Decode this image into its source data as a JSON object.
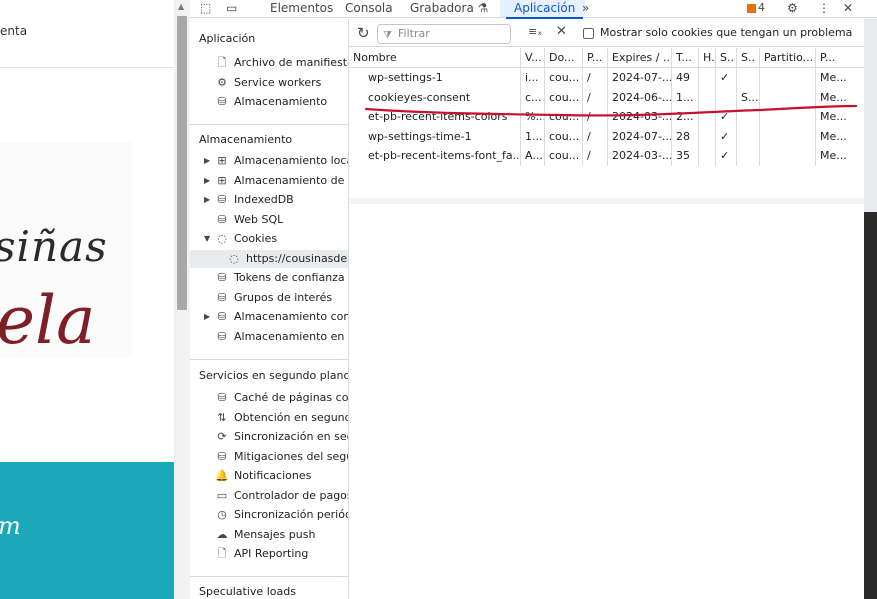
{
  "website": {
    "top_text": "enta",
    "logo_line1": "siñas",
    "logo_line2": "ela",
    "banner_text": "m"
  },
  "devtools": {
    "toolbar": {
      "tabs": [
        "Elementos",
        "Consola",
        "Grabadora",
        "Aplicación"
      ],
      "active_tab": "Aplicación",
      "more": "»",
      "issues_count": "4",
      "gear": "⚙",
      "menu": "⋮",
      "close": "✕"
    },
    "sidebar": {
      "app_title": "Aplicación",
      "app_items": [
        {
          "icon": "file-icon",
          "glyph": "🗋",
          "label": "Archivo de manifiesto"
        },
        {
          "icon": "gears-icon",
          "glyph": "⚙",
          "label": "Service workers"
        },
        {
          "icon": "database-icon",
          "glyph": "⛁",
          "label": "Almacenamiento"
        }
      ],
      "storage_title": "Almacenamiento",
      "storage_items": [
        {
          "icon": "table-icon",
          "glyph": "⊞",
          "label": "Almacenamiento local",
          "expandable": true
        },
        {
          "icon": "table-icon",
          "glyph": "⊞",
          "label": "Almacenamiento de sesión",
          "expandable": true
        },
        {
          "icon": "database-icon",
          "glyph": "⛁",
          "label": "IndexedDB",
          "expandable": true
        },
        {
          "icon": "database-icon",
          "glyph": "⛁",
          "label": "Web SQL",
          "expandable": false
        },
        {
          "icon": "cookie-icon",
          "glyph": "◌",
          "label": "Cookies",
          "expanded": true
        },
        {
          "icon": "cookie-icon",
          "glyph": "◌",
          "label": "https://cousinasdekela.com",
          "child": true,
          "selected": true
        },
        {
          "icon": "database-icon",
          "glyph": "⛁",
          "label": "Tokens de confianza"
        },
        {
          "icon": "database-icon",
          "glyph": "⛁",
          "label": "Grupos de interés"
        },
        {
          "icon": "database-icon",
          "glyph": "⛁",
          "label": "Almacenamiento compartido",
          "expandable": true
        },
        {
          "icon": "database-icon",
          "glyph": "⛁",
          "label": "Almacenamiento en caché"
        }
      ],
      "bg_title": "Servicios en segundo plano",
      "bg_items": [
        {
          "icon": "database-icon",
          "glyph": "⛁",
          "label": "Caché de páginas completas"
        },
        {
          "icon": "sync-arrows-icon",
          "glyph": "⇅",
          "label": "Obtención en segundo plano"
        },
        {
          "icon": "sync-icon",
          "glyph": "⟳",
          "label": "Sincronización en segundo plano"
        },
        {
          "icon": "database-icon",
          "glyph": "⛁",
          "label": "Mitigaciones del seguimiento"
        },
        {
          "icon": "bell-icon",
          "glyph": "🔔",
          "label": "Notificaciones"
        },
        {
          "icon": "card-icon",
          "glyph": "▭",
          "label": "Controlador de pagos"
        },
        {
          "icon": "clock-icon",
          "glyph": "◷",
          "label": "Sincronización periódica"
        },
        {
          "icon": "cloud-icon",
          "glyph": "☁",
          "label": "Mensajes push"
        },
        {
          "icon": "file-icon",
          "glyph": "🗋",
          "label": "API Reporting"
        }
      ],
      "spec_title": "Speculative loads"
    },
    "filter": {
      "placeholder": "Filtrar",
      "checkbox_label": "Mostrar solo cookies que tengan un problema"
    },
    "table": {
      "headers": [
        "Nombre",
        "V...",
        "Do...",
        "P...",
        "Expires / ...",
        "T...",
        "H.",
        "S..",
        "S..",
        "Partitio...",
        "P..."
      ],
      "rows": [
        [
          "wp-settings-1",
          "i...",
          "cou...",
          "/",
          "2024-07-...",
          "49",
          "",
          "✓",
          "",
          "",
          "Me..."
        ],
        [
          "cookieyes-consent",
          "c...",
          "cou...",
          "/",
          "2024-06-...",
          "1...",
          "",
          "",
          "S...",
          "",
          "Me..."
        ],
        [
          "et-pb-recent-items-colors",
          "%...",
          "cou...",
          "/",
          "2024-03-...",
          "2...",
          "",
          "✓",
          "",
          "",
          "Me..."
        ],
        [
          "wp-settings-time-1",
          "1...",
          "cou...",
          "/",
          "2024-07-...",
          "28",
          "",
          "✓",
          "",
          "",
          "Me..."
        ],
        [
          "et-pb-recent-items-font_fa...",
          "A...",
          "cou...",
          "/",
          "2024-03-...",
          "35",
          "",
          "✓",
          "",
          "",
          "Me..."
        ]
      ]
    },
    "annotation_color": "#c8102e"
  }
}
